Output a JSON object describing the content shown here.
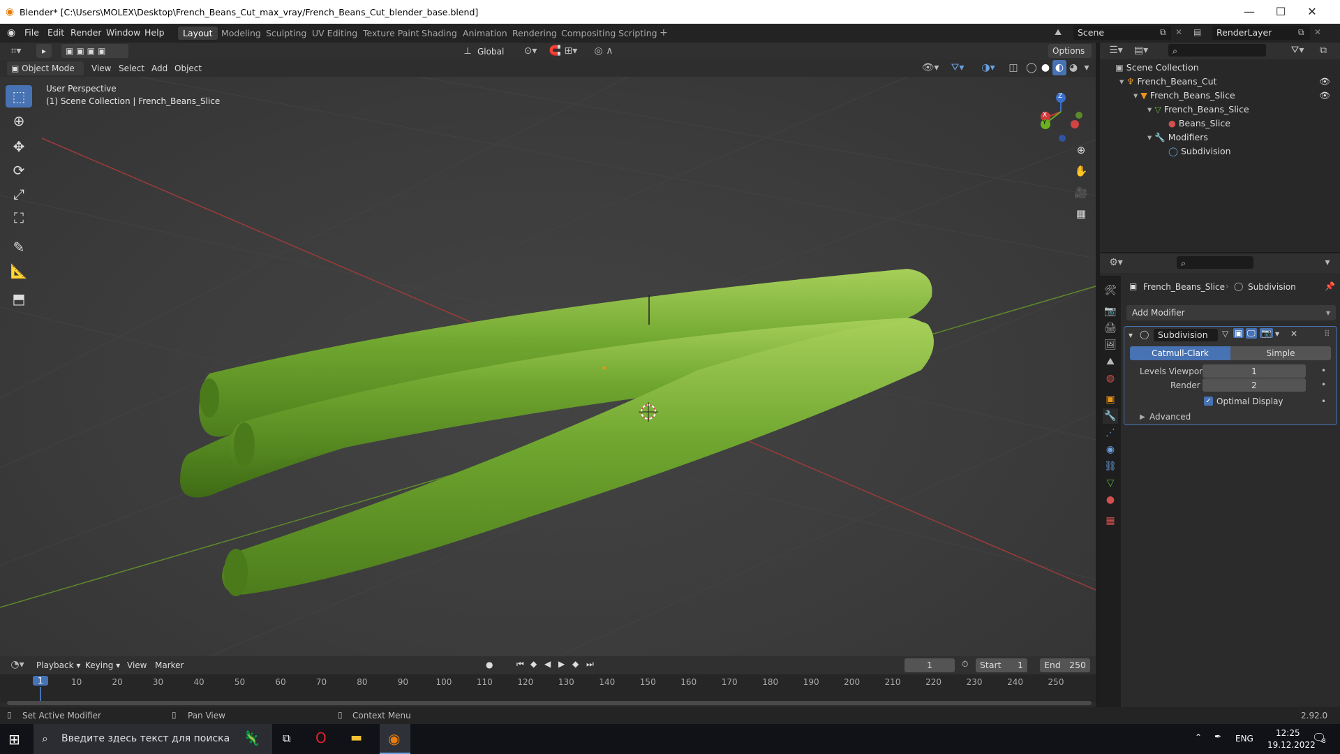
{
  "window": {
    "title": "Blender* [C:\\Users\\MOLEX\\Desktop\\French_Beans_Cut_max_vray/French_Beans_Cut_blender_base.blend]",
    "minimize": "—",
    "maximize": "☐",
    "close": "✕"
  },
  "menu": [
    "File",
    "Edit",
    "Render",
    "Window",
    "Help"
  ],
  "workspaces": [
    "Layout",
    "Modeling",
    "Sculpting",
    "UV Editing",
    "Texture Paint",
    "Shading",
    "Animation",
    "Rendering",
    "Compositing",
    "Scripting"
  ],
  "active_workspace": "Layout",
  "scene": "Scene",
  "render_layer": "RenderLayer",
  "viewport_header": {
    "transform_orientation": "Global",
    "options": "Options",
    "mode": "Object Mode",
    "menus": [
      "View",
      "Select",
      "Add",
      "Object"
    ]
  },
  "viewport": {
    "perspective": "User Perspective",
    "collection_info": "(1) Scene Collection | French_Beans_Slice"
  },
  "gizmo": {
    "x": "X",
    "y": "Y",
    "z": "Z"
  },
  "outliner": {
    "items": [
      {
        "label": "Scene Collection",
        "depth": 0,
        "icon": "collection-icon"
      },
      {
        "label": "French_Beans_Cut",
        "depth": 1,
        "icon": "armature-icon"
      },
      {
        "label": "French_Beans_Slice",
        "depth": 2,
        "icon": "object-icon"
      },
      {
        "label": "French_Beans_Slice",
        "depth": 3,
        "icon": "mesh-icon"
      },
      {
        "label": "Beans_Slice",
        "depth": 4,
        "icon": "material-icon"
      },
      {
        "label": "Modifiers",
        "depth": 3,
        "icon": "wrench-icon"
      },
      {
        "label": "Subdivision",
        "depth": 4,
        "icon": "modifier-icon"
      }
    ]
  },
  "properties": {
    "object_name": "French_Beans_Slice",
    "modifier_crumb": "Subdivision",
    "add_modifier": "Add Modifier",
    "modifier": {
      "name": "Subdivision",
      "type_options": [
        "Catmull-Clark",
        "Simple"
      ],
      "selected_type": "Catmull-Clark",
      "levels_viewport_label": "Levels Viewport",
      "levels_viewport": "1",
      "render_label": "Render",
      "render": "2",
      "optimal_display_label": "Optimal Display",
      "optimal_display": true,
      "advanced_label": "Advanced"
    }
  },
  "timeline": {
    "menus": [
      "Playback",
      "Keying",
      "View",
      "Marker"
    ],
    "current_frame": "1",
    "start_label": "Start",
    "start": "1",
    "end_label": "End",
    "end": "250",
    "ticks": [
      "1",
      "10",
      "20",
      "30",
      "40",
      "50",
      "60",
      "70",
      "80",
      "90",
      "100",
      "110",
      "120",
      "130",
      "140",
      "150",
      "160",
      "170",
      "180",
      "190",
      "200",
      "210",
      "220",
      "230",
      "240",
      "250"
    ]
  },
  "statusbar": {
    "hints": [
      "Set Active Modifier",
      "Pan View",
      "Context Menu"
    ],
    "version": "2.92.0"
  },
  "taskbar": {
    "search_placeholder": "Введите здесь текст для поиска",
    "lang": "ENG",
    "time": "12:25",
    "date": "19.12.2022",
    "notifications": "8"
  },
  "colors": {
    "accent": "#4772b3",
    "bean_green": "#6aa12d",
    "axis_x": "#c0392b",
    "axis_y": "#6a9a2a"
  }
}
